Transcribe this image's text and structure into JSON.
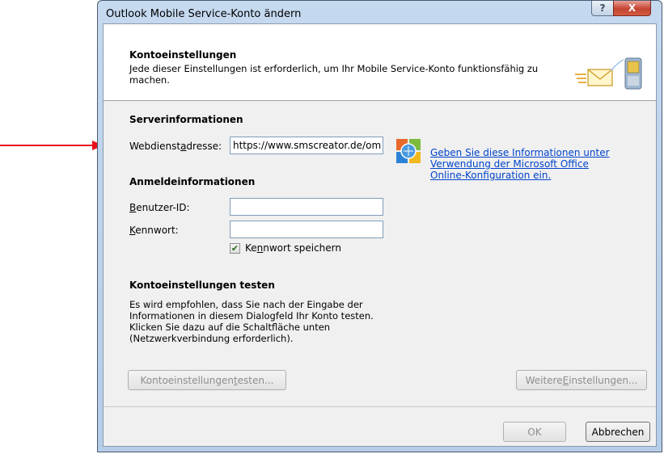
{
  "window": {
    "title": "Outlook Mobile Service-Konto ändern",
    "help_glyph": "?",
    "close_glyph": "X"
  },
  "header": {
    "title": "Kontoeinstellungen",
    "description": "Jede dieser Einstellungen ist erforderlich, um Ihr Mobile Service-Konto funktionsfähig zu machen.",
    "icon": "mail-to-mobile-icon"
  },
  "server": {
    "section_title": "Serverinformationen",
    "webservice_label_pre": "Webdienst",
    "webservice_label_accel": "a",
    "webservice_label_post": "dresse:",
    "webservice_value": "https://www.smscreator.de/om"
  },
  "info_link": {
    "icon": "office-online-icon",
    "text": "Geben Sie diese Informationen unter Verwendung der Microsoft Office Online-Konfiguration ein."
  },
  "login": {
    "section_title": "Anmeldeinformationen",
    "userid_label_accel": "B",
    "userid_label_post": "enutzer-ID:",
    "userid_value": "",
    "password_label_accel": "K",
    "password_label_post": "ennwort:",
    "password_value": "",
    "save_password_pre": "Ke",
    "save_password_accel": "n",
    "save_password_post": "nwort speichern",
    "save_password_checked": true
  },
  "test": {
    "section_title": "Kontoeinstellungen testen",
    "description": "Es wird empfohlen, dass Sie nach der Eingabe der Informationen in diesem Dialogfeld Ihr Konto testen. Klicken Sie dazu auf die Schaltfläche unten (Netzwerkverbindung erforderlich).",
    "test_button_pre": "Kontoeinstellungen ",
    "test_button_accel": "t",
    "test_button_post": "esten...",
    "more_button_pre": "Weitere ",
    "more_button_accel": "E",
    "more_button_post": "instellungen..."
  },
  "footer": {
    "ok_label": "OK",
    "cancel_label": "Abbrechen"
  },
  "annotation": {
    "arrow_color": "#e8101a"
  }
}
